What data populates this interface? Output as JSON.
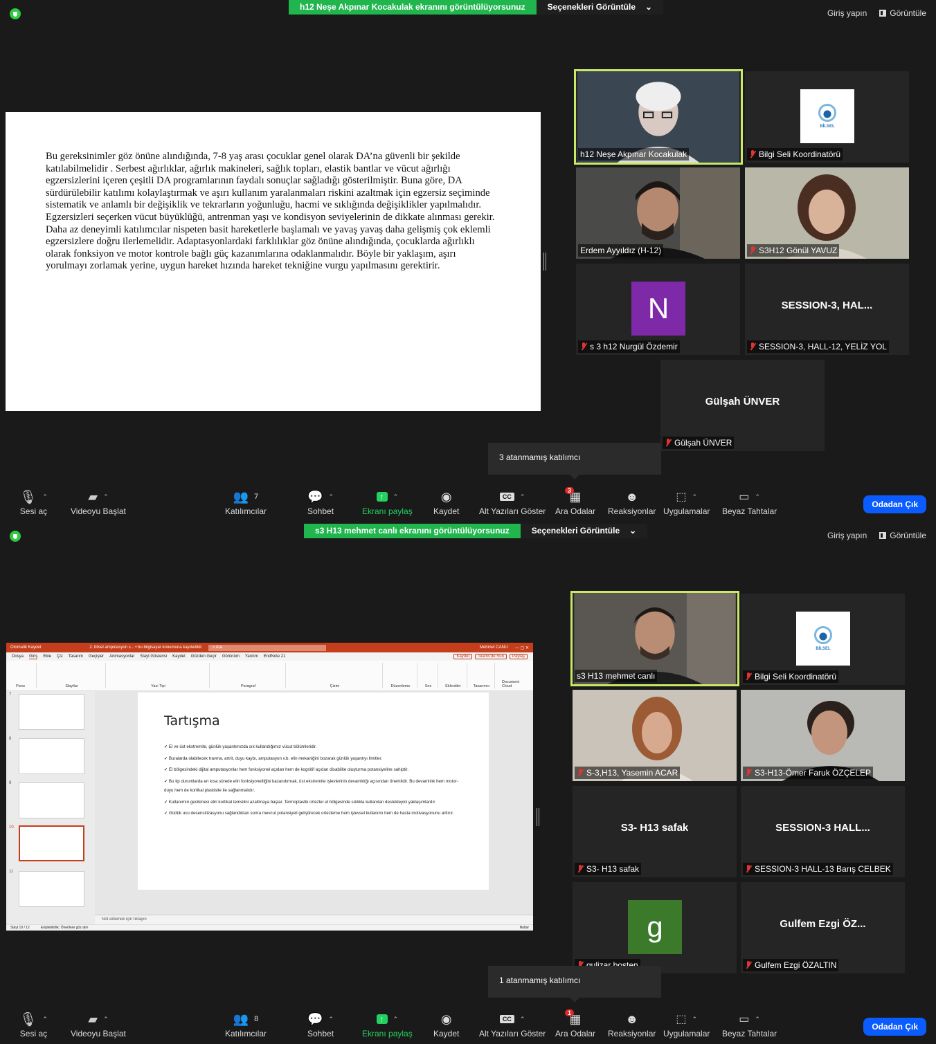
{
  "s1": {
    "share_text": "h12 Neşe Akpınar Kocakulak ekranını görüntülüyorsunuz",
    "view_options": "Seçenekleri Görüntüle",
    "signin": "Giriş yapın",
    "view": "Görüntüle",
    "slide_text": "Bu gereksinimler göz önüne alındığında, 7-8 yaş arası çocuklar genel olarak  DA’na güvenli bir şekilde katılabilmelidir . Serbest ağırlıklar, ağırlık makineleri, sağlık topları, elastik bantlar ve vücut ağırlığı egzersizlerini içeren çeşitli DA programlarının faydalı sonuçlar sağladığı gösterilmiştir. Buna göre, DA sürdürülebilir katılımı kolaylaştırmak ve aşırı kullanım yaralanmaları riskini azaltmak için egzersiz seçiminde sistematik ve anlamlı bir değişiklik ve tekrarların yoğunluğu, hacmi ve sıklığında değişiklikler yapılmalıdır. Egzersizleri seçerken vücut büyüklüğü, antrenman yaşı ve kondisyon seviyelerinin de dikkate alınması gerekir. Daha az deneyimli katılımcılar nispeten basit hareketlerle başlamalı ve yavaş yavaş daha gelişmiş çok eklemli egzersizlere doğru ilerlemelidir. Adaptasyonlardaki farklılıklar göz önüne alındığında, çocuklarda ağırlıklı olarak fonksiyon ve motor kontrole bağlı güç kazanımlarına odaklanmalıdır. Böyle bir yaklaşım, aşırı yorulmayı zorlamak yerine, uygun hareket hızında hareket tekniğine vurgu yapılmasını gerektirir.",
    "tiles": {
      "t1": "h12 Neşe Akpınar Kocakulak",
      "t2": "Bilgi Seli Koordinatörü",
      "t3": "Erdem Ayyıldız (H-12)",
      "t4": "S3H12 Gönül YAVUZ",
      "t5_letter": "N",
      "t5": "s 3 h12 Nurgül Özdemir",
      "t6_big": "SESSION-3,  HAL...",
      "t6": "SESSION-3, HALL-12, YELİZ YOL",
      "t7_big": "Gülşah ÜNVER",
      "t7": "Gülşah ÜNVER"
    },
    "tooltip": "3 atanmamış katılımcı",
    "participants_count": "7",
    "breakout_badge": "3"
  },
  "s2": {
    "share_text": "s3 H13 mehmet canlı ekranını görüntülüyorsunuz",
    "view_options": "Seçenekleri Görüntüle",
    "signin": "Giriş yapın",
    "view": "Görüntüle",
    "ppt": {
      "autosave": "Otomatik Kaydet",
      "doc_title": "2. bilsel amputasyon s... • bu bilgisayar konumuna kaydedildi",
      "search": "Ara",
      "user": "Mehmet CANLI",
      "tabs": [
        "Dosya",
        "Giriş",
        "Ekle",
        "Çiz",
        "Tasarım",
        "Geçişler",
        "Animasyonlar",
        "Slayt Gösterisi",
        "Kaydet",
        "Gözden Geçir",
        "Görünüm",
        "Yardım",
        "EndNote 21"
      ],
      "btn_record": "Kaydet",
      "btn_teams": "Teams'de Sun",
      "btn_share": "Paylaş",
      "ribbon": [
        "Pano",
        "Slaytlar",
        "Yazı Tipi",
        "Paragraf",
        "Çizim",
        "Düzenleme",
        "Ses",
        "Eklentiler",
        "Tasarımcı",
        "Document Cloud"
      ],
      "thumb_nums": [
        "7",
        "8",
        "9",
        "10",
        "11"
      ],
      "slide_title": "Tartışma",
      "bullets": [
        "El ve üst ekstremite, günlük yaşantımızda sık kullandığımız vücut bölümleridir.",
        "Buralarda olabilecek travma, artrit, duyu kaybı, amputasyon v.b. elin mekaniğini bozarak günlük yaşantıyı limitler.",
        "El bölgesindeki dijital amputasyonlar hem fonksiyonel açıdan hem de kognitif açıdan disabilite oluşturma potansiyeline sahiptir.",
        "Bu tip durumlarda en kısa sürede elin fonksiyonelliğini kazandırmak, üst ekstremite işlevlerinin devamlılığı açısından önemlidir. Bu devamlılık hem motor-duyu hem de kortikal plastisite ile sağlanmalıdır.",
        "Kullanımın gecikmesi elin kortikal temsilini azaltmaya başlar. Termoplastik ortezler el bölgesinde sıklıkla kullanılan destekleyici yaklaşımlardır.",
        "Güdük ucu desensitizasyonu sağlandıktan sonra mevcut potansiyeli geliştirecek ortezleme hem işlevsel kullanımı hem de hasta motivasyonunu arttırır."
      ],
      "notes": "Not eklemek için tıklayın",
      "status": "Slayt 10 / 12",
      "accessibility": "Erişilebilirlik: Önerilere göz atın",
      "notes_btn": "Notlar"
    },
    "tiles": {
      "t1": "s3 H13 mehmet canlı",
      "t2": "Bilgi Seli Koordinatörü",
      "t3": "S-3,H13, Yasemin ACAR",
      "t4": "S3-H13-Ömer Faruk ÖZÇELEP",
      "t5_big": "S3- H13 safak",
      "t5": "S3- H13 safak",
      "t6_big": "SESSION-3  HALL...",
      "t6": "SESSION-3 HALL-13 Barış CELBEK",
      "t7_letter": "g",
      "t7": "gulizar bosten",
      "t8_big": "Gulfem Ezgi ÖZ...",
      "t8": "Gulfem Ezgi ÖZALTIN"
    },
    "tooltip": "1 atanmamış katılımcı",
    "participants_count": "8",
    "breakout_badge": "1"
  },
  "logo_text": "BİLSEL",
  "toolbar": {
    "unmute": "Sesi aç",
    "start_video": "Videoyu Başlat",
    "participants": "Katılımcılar",
    "chat": "Sohbet",
    "share": "Ekranı paylaş",
    "record": "Kaydet",
    "captions": "Alt Yazıları Göster",
    "breakout": "Ara Odalar",
    "reactions": "Reaksiyonlar",
    "apps": "Uygulamalar",
    "whiteboards": "Beyaz Tahtalar",
    "leave": "Odadan Çık",
    "cc": "CC"
  },
  "colors": {
    "share_green": "#20b54d",
    "active_border": "#c9e865",
    "leave_blue": "#0b5cff",
    "avatar_purple": "#7e2aa8",
    "avatar_green": "#3a7a2a",
    "ppt_red": "#c43e1c"
  }
}
